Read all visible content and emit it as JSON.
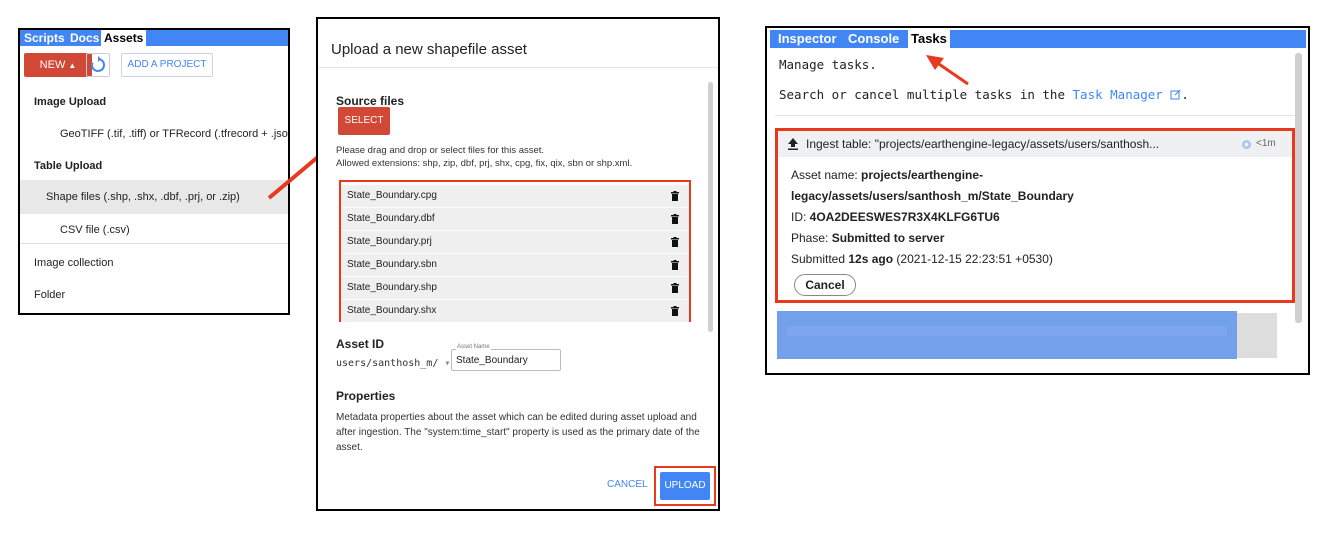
{
  "assets_panel": {
    "tabs": [
      "Scripts",
      "Docs",
      "Assets"
    ],
    "active_tab": "Assets",
    "new_button": "NEW",
    "add_project_button": "ADD A PROJECT",
    "sections": {
      "image_upload": "Image Upload",
      "geotiff": "GeoTIFF (.tif, .tiff) or TFRecord (.tfrecord + .json)",
      "table_upload": "Table Upload",
      "shape_files": "Shape files (.shp, .shx, .dbf, .prj, or .zip)",
      "csv_file": "CSV file (.csv)",
      "image_collection": "Image collection",
      "folder": "Folder"
    }
  },
  "upload_dialog": {
    "title": "Upload a new shapefile asset",
    "source_files_heading": "Source files",
    "select_button": "SELECT",
    "help_line1": "Please drag and drop or select files for this asset.",
    "help_line2": "Allowed extensions: shp, zip, dbf, prj, shx, cpg, fix, qix, sbn or shp.xml.",
    "files": [
      "State_Boundary.cpg",
      "State_Boundary.dbf",
      "State_Boundary.prj",
      "State_Boundary.sbn",
      "State_Boundary.shp",
      "State_Boundary.shx"
    ],
    "asset_id_heading": "Asset ID",
    "asset_id_prefix": "users/santhosh_m/",
    "asset_name_label": "Asset Name",
    "asset_name_value": "State_Boundary",
    "properties_heading": "Properties",
    "properties_text": "Metadata properties about the asset which can be edited during asset upload and after ingestion. The \"system:time_start\" property is used as the primary date of the asset.",
    "cancel_button": "CANCEL",
    "upload_button": "UPLOAD"
  },
  "tasks_panel": {
    "tabs": [
      "Inspector",
      "Console",
      "Tasks"
    ],
    "active_tab": "Tasks",
    "manage_text": "Manage tasks.",
    "search_text": "Search or cancel multiple tasks in the",
    "task_manager_link": "Task Manager",
    "search_text_end": ".",
    "task": {
      "header": "Ingest table: \"projects/earthengine-legacy/assets/users/santhosh...",
      "time": "<1m",
      "asset_name_label": "Asset name: ",
      "asset_name_line1": "projects/earthengine-",
      "asset_name_line2": "legacy/assets/users/santhosh_m/State_Boundary",
      "id_label": "ID: ",
      "id_value": "4OA2DEESWES7R3X4KLFG6TU6",
      "phase_label": "Phase: ",
      "phase_value": "Submitted to server",
      "submitted_label": "Submitted ",
      "submitted_ago": "12s ago",
      "submitted_date": "(2021-12-15 22:23:51 +0530)",
      "cancel_button": "Cancel"
    }
  },
  "colors": {
    "tab_blue": "#4285f4",
    "new_red": "#d14836",
    "highlight_red": "#e8391f"
  }
}
